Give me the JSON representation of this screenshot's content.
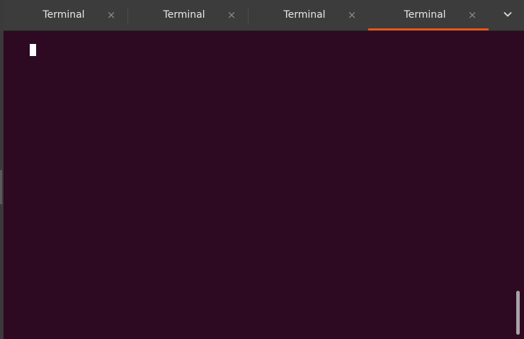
{
  "colors": {
    "terminal_background": "#2d0922",
    "tab_bar_background": "#3c3c3c",
    "active_tab_accent": "#e95420",
    "cursor": "#ffffff"
  },
  "tabs": [
    {
      "label": "Terminal",
      "close_symbol": "×",
      "active": false
    },
    {
      "label": "Terminal",
      "close_symbol": "×",
      "active": false
    },
    {
      "label": "Terminal",
      "close_symbol": "×",
      "active": false
    },
    {
      "label": "Terminal",
      "close_symbol": "×",
      "active": true
    }
  ],
  "tabs_menu": {
    "icon": "chevron-down-icon"
  },
  "terminal": {
    "content": "",
    "cursor_style": "block"
  },
  "scrollbar": {
    "position": "bottom"
  }
}
